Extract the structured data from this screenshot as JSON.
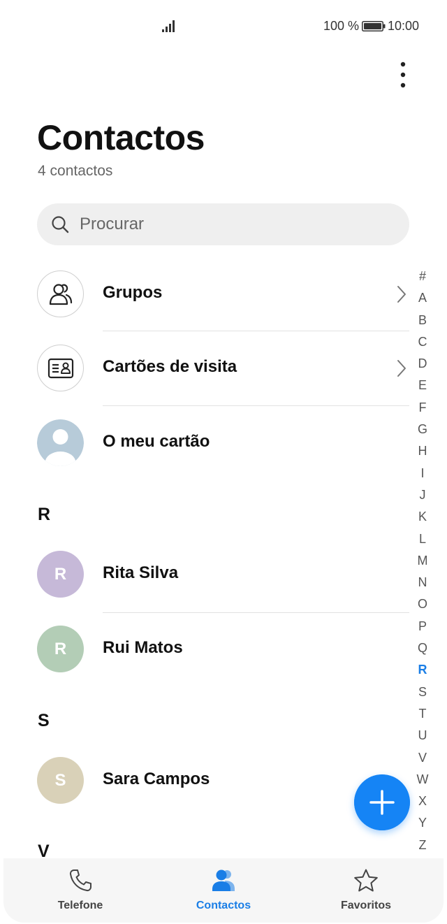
{
  "status_bar": {
    "battery_percent": "100 %",
    "time": "10:00"
  },
  "header": {
    "title": "Contactos",
    "subtitle": "4 contactos"
  },
  "search": {
    "placeholder": "Procurar"
  },
  "menu_rows": [
    {
      "label": "Grupos",
      "icon": "groups-icon"
    },
    {
      "label": "Cartões de visita",
      "icon": "business-card-icon"
    },
    {
      "label": "O meu cartão",
      "icon": "default-avatar-icon"
    }
  ],
  "sections": [
    {
      "letter": "R",
      "contacts": [
        {
          "initial": "R",
          "name": "Rita Silva",
          "color": "#c6b9d8"
        },
        {
          "initial": "R",
          "name": "Rui Matos",
          "color": "#b3cdb6"
        }
      ]
    },
    {
      "letter": "S",
      "contacts": [
        {
          "initial": "S",
          "name": "Sara Campos",
          "color": "#d9d1b8"
        }
      ]
    },
    {
      "letter": "V",
      "contacts": []
    }
  ],
  "alphabet_index": [
    "#",
    "A",
    "B",
    "C",
    "D",
    "E",
    "F",
    "G",
    "H",
    "I",
    "J",
    "K",
    "L",
    "M",
    "N",
    "O",
    "P",
    "Q",
    "R",
    "S",
    "T",
    "U",
    "V",
    "W",
    "X",
    "Y",
    "Z"
  ],
  "alphabet_active": "R",
  "bottom_nav": [
    {
      "label": "Telefone",
      "icon": "phone-icon",
      "active": false
    },
    {
      "label": "Contactos",
      "icon": "contacts-icon",
      "active": true
    },
    {
      "label": "Favoritos",
      "icon": "star-icon",
      "active": false
    }
  ],
  "colors": {
    "accent": "#1a7ee6",
    "fab": "#1584f5"
  }
}
